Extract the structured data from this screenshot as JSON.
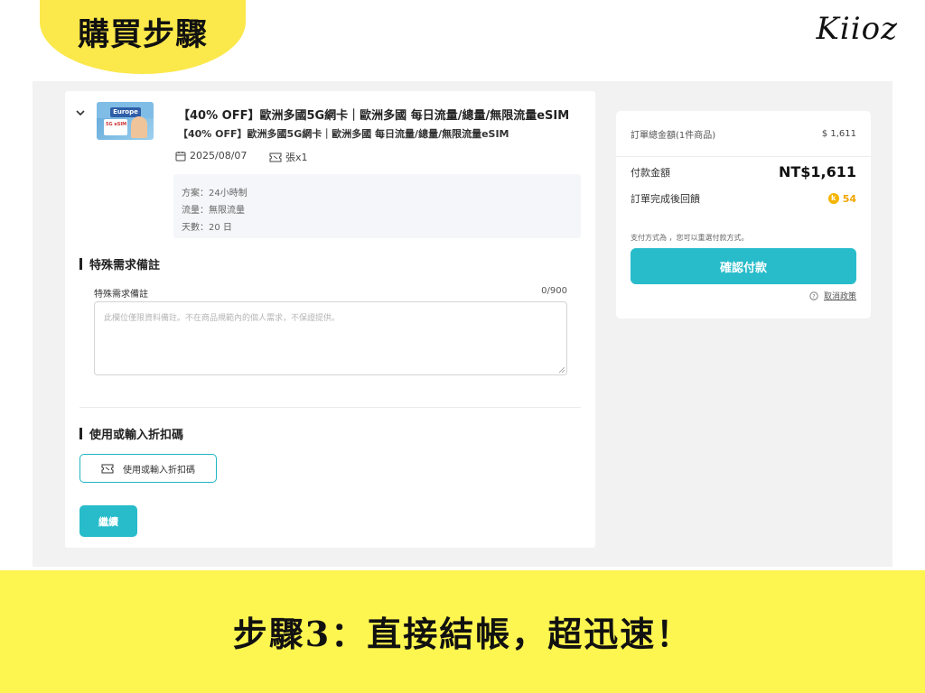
{
  "header": {
    "step_title": "購買步驟",
    "logo_text": "Kiioz"
  },
  "product": {
    "thumbnail_text": "Europe",
    "thumbnail_card_text": "5G eSIM",
    "title": "【40% OFF】歐洲多國5G網卡｜歐洲多國 每日流量/總量/無限流量eSIM",
    "subtitle": "【40% OFF】歐洲多國5G網卡｜歐洲多國 每日流量/總量/無限流量eSIM",
    "date": "2025/08/07",
    "quantity": "張x1",
    "details": [
      "方案：24小時制",
      "流量：無限流量",
      "天數：20 日"
    ]
  },
  "special_request": {
    "section_title": "特殊需求備註",
    "field_label": "特殊需求備註",
    "char_count": "0/900",
    "value": "",
    "placeholder": "此欄位僅限資料備註。不在商品規範內的個人需求，不保證提供。"
  },
  "coupon": {
    "section_title": "使用或輸入折扣碼",
    "button_label": "使用或輸入折扣碼"
  },
  "continue_label": "繼續",
  "summary": {
    "total_label": "訂單總金額(1件商品)",
    "total_value": "$ 1,611",
    "pay_label": "付款金額",
    "pay_value": "NT$1,611",
    "reward_label": "訂單完成後回饋",
    "reward_value": "54",
    "pay_method_note": "支付方式為 ，您可以重選付款方式。",
    "confirm_label": "確認付款",
    "cancel_policy": "取消政策"
  },
  "footer": {
    "text": "步驟3：直接結帳，超迅速！"
  },
  "colors": {
    "brand_yellow": "#fdf550",
    "accent_teal": "#28bccb",
    "reward_orange": "#f2a500"
  },
  "icons": [
    "chevron-down-icon",
    "calendar-icon",
    "ticket-icon",
    "coin-icon",
    "help-circle-icon"
  ]
}
